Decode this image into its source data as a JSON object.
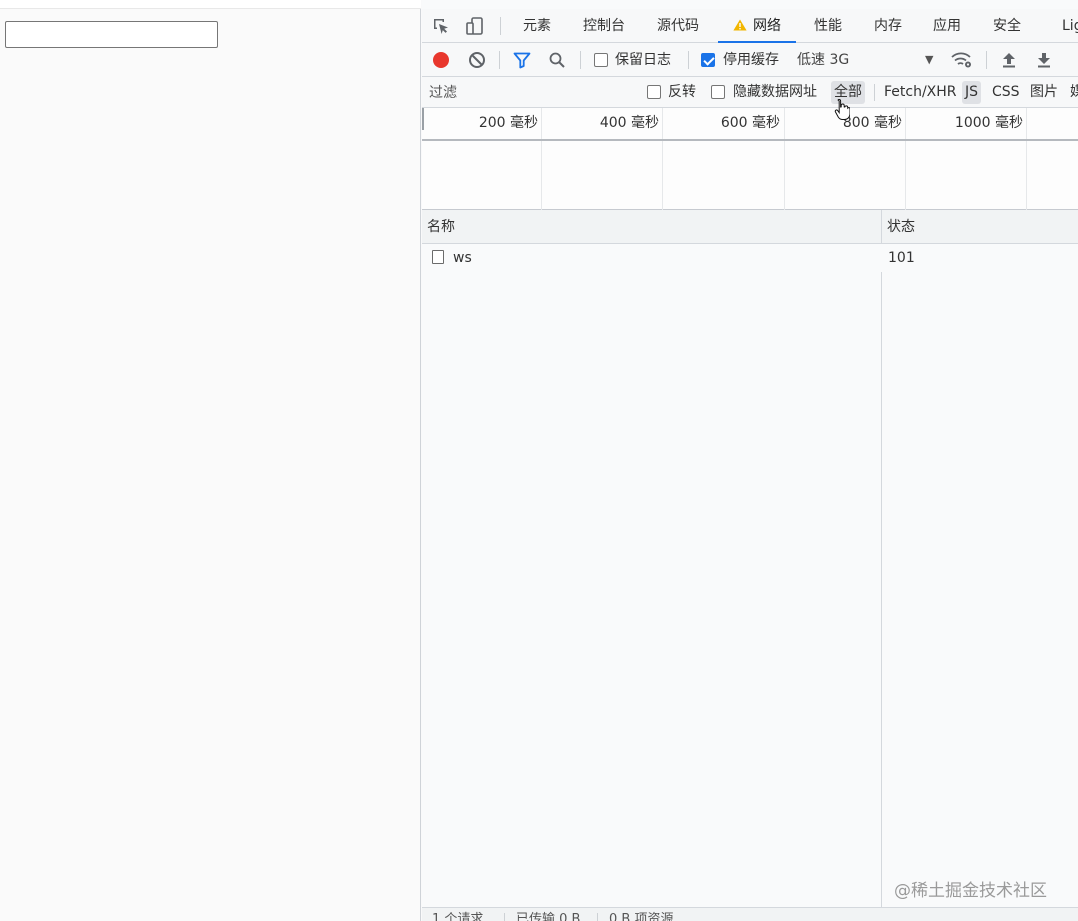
{
  "page": {
    "input_value": ""
  },
  "devtools": {
    "tabs": [
      {
        "label": "元素"
      },
      {
        "label": "控制台"
      },
      {
        "label": "源代码"
      },
      {
        "label": "网络"
      },
      {
        "label": "性能"
      },
      {
        "label": "内存"
      },
      {
        "label": "应用"
      },
      {
        "label": "安全"
      },
      {
        "label": "Lig"
      }
    ],
    "active_tab": "网络",
    "toolbar": {
      "preserve_log_label": "保留日志",
      "preserve_log_checked": false,
      "disable_cache_label": "停用缓存",
      "disable_cache_checked": true,
      "throttle_value": "低速 3G"
    },
    "filter": {
      "placeholder": "过滤",
      "invert_label": "反转",
      "hide_data_urls_label": "隐藏数据网址",
      "types": [
        {
          "label": "全部",
          "selected": true
        },
        {
          "label": "Fetch/XHR",
          "selected": false
        },
        {
          "label": "JS",
          "selected": true
        },
        {
          "label": "CSS",
          "selected": false
        },
        {
          "label": "图片",
          "selected": false
        },
        {
          "label": "媒",
          "selected": false
        }
      ]
    },
    "timeline": {
      "ticks": [
        "200 毫秒",
        "400 毫秒",
        "600 毫秒",
        "800 毫秒",
        "1000 毫秒"
      ]
    },
    "table": {
      "columns": [
        "名称",
        "状态"
      ],
      "rows": [
        {
          "name": "ws",
          "status": "101"
        }
      ]
    },
    "status": {
      "requests": "1 个请求",
      "transferred": "已传输 0 B",
      "resources": "0 B 项资源"
    }
  },
  "watermark": "@稀土掘金技术社区",
  "colors": {
    "accent": "#1a73e8",
    "record": "#e8372d",
    "warning": "#f2b600"
  }
}
